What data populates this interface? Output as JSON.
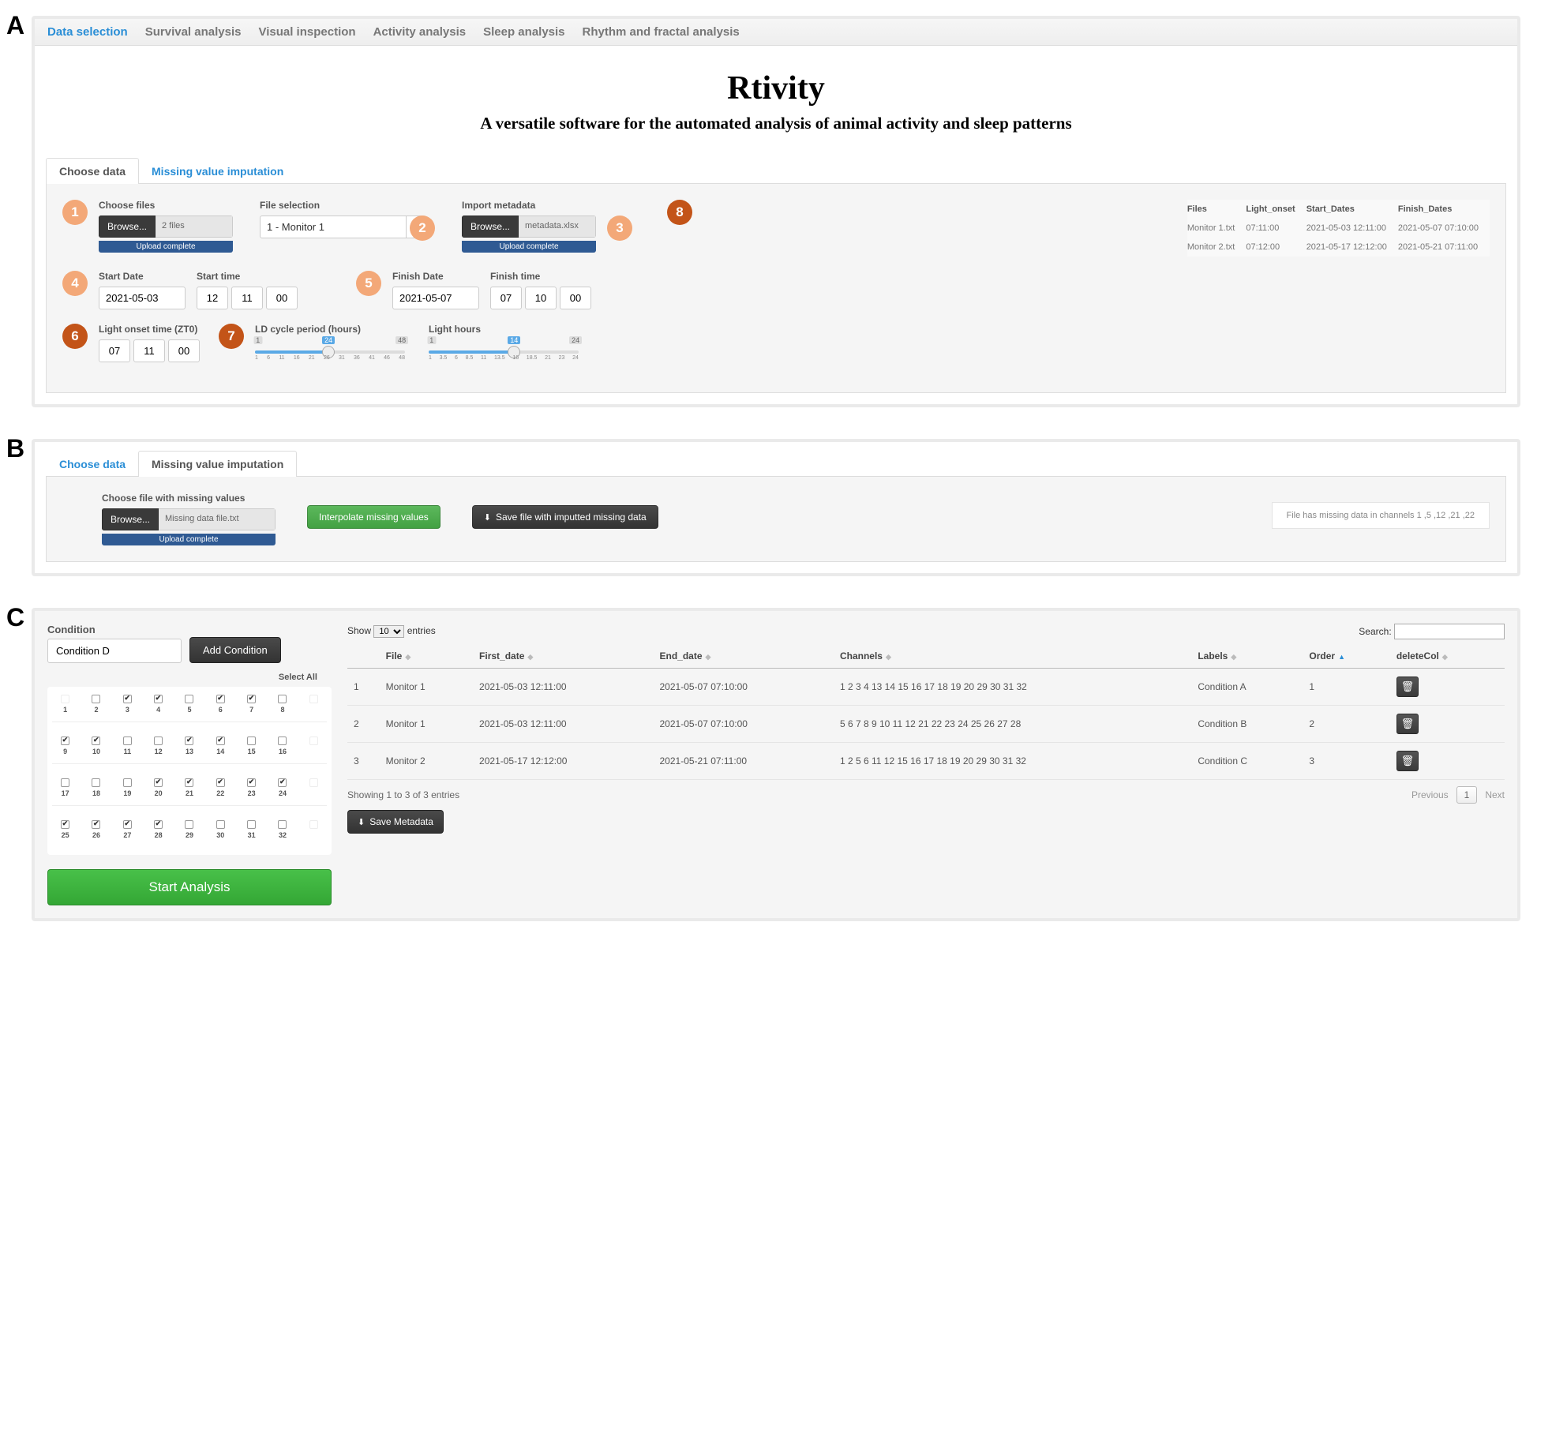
{
  "labels": {
    "A": "A",
    "B": "B",
    "C": "C"
  },
  "nav": {
    "items": [
      {
        "label": "Data selection",
        "active": true
      },
      {
        "label": "Survival analysis"
      },
      {
        "label": "Visual inspection"
      },
      {
        "label": "Activity analysis"
      },
      {
        "label": "Sleep analysis"
      },
      {
        "label": "Rhythm and fractal analysis"
      }
    ]
  },
  "hero": {
    "title": "Rtivity",
    "subtitle": "A versatile software for the automated analysis of animal activity and sleep patterns"
  },
  "tabs": {
    "choose_data": "Choose data",
    "missing_imputation": "Missing value imputation"
  },
  "callouts": [
    "1",
    "2",
    "3",
    "4",
    "5",
    "6",
    "7",
    "8"
  ],
  "panelA": {
    "choose_files_label": "Choose files",
    "browse_label": "Browse...",
    "files_count_text": "2 files",
    "upload_complete": "Upload complete",
    "file_selection_label": "File selection",
    "file_selection_value": "1 - Monitor 1",
    "import_metadata_label": "Import metadata",
    "metadata_filename": "metadata.xlsx",
    "start_date_label": "Start Date",
    "start_date_value": "2021-05-03",
    "start_time_label": "Start time",
    "start_time": {
      "h": "12",
      "m": "11",
      "s": "00"
    },
    "finish_date_label": "Finish Date",
    "finish_date_value": "2021-05-07",
    "finish_time_label": "Finish time",
    "finish_time": {
      "h": "07",
      "m": "10",
      "s": "00"
    },
    "zt0_label": "Light onset time (ZT0)",
    "zt0": {
      "h": "07",
      "m": "11",
      "s": "00"
    },
    "ld_label": "LD cycle period (hours)",
    "ld": {
      "min": "1",
      "value": "24",
      "max": "48",
      "ticks": [
        "1",
        "6",
        "11",
        "16",
        "21",
        "26",
        "31",
        "36",
        "41",
        "46",
        "48"
      ]
    },
    "light_label": "Light hours",
    "light": {
      "min": "1",
      "value": "14",
      "max": "24",
      "ticks": [
        "1",
        "3.5",
        "6",
        "8.5",
        "11",
        "13.5",
        "16",
        "18.5",
        "21",
        "23",
        "24"
      ]
    },
    "meta_headers": [
      "Files",
      "Light_onset",
      "Start_Dates",
      "Finish_Dates"
    ],
    "meta_rows": [
      {
        "file": "Monitor 1.txt",
        "onset": "07:11:00",
        "start": "2021-05-03 12:11:00",
        "finish": "2021-05-07 07:10:00"
      },
      {
        "file": "Monitor 2.txt",
        "onset": "07:12:00",
        "start": "2021-05-17 12:12:00",
        "finish": "2021-05-21 07:11:00"
      }
    ]
  },
  "panelB": {
    "choose_label": "Choose file with missing values",
    "filename": "Missing data file.txt",
    "interpolate_label": "Interpolate missing values",
    "save_label": "Save file with imputted missing data",
    "info_text": "File has missing data in channels 1 ,5 ,12 ,21 ,22"
  },
  "panelC": {
    "condition_label": "Condition",
    "condition_value": "Condition D",
    "add_condition_label": "Add Condition",
    "select_all_label": "Select All",
    "channels": [
      [
        {
          "n": "1",
          "c": false,
          "dim": true
        },
        {
          "n": "2",
          "c": false
        },
        {
          "n": "3",
          "c": true
        },
        {
          "n": "4",
          "c": true
        },
        {
          "n": "5",
          "c": false
        },
        {
          "n": "6",
          "c": true
        },
        {
          "n": "7",
          "c": true
        },
        {
          "n": "8",
          "c": false
        },
        {
          "n": "",
          "dim": true
        }
      ],
      [
        {
          "n": "9",
          "c": true
        },
        {
          "n": "10",
          "c": true
        },
        {
          "n": "11",
          "c": false
        },
        {
          "n": "12",
          "c": false
        },
        {
          "n": "13",
          "c": true
        },
        {
          "n": "14",
          "c": true
        },
        {
          "n": "15",
          "c": false
        },
        {
          "n": "16",
          "c": false
        },
        {
          "n": "",
          "dim": true
        }
      ],
      [
        {
          "n": "17",
          "c": false
        },
        {
          "n": "18",
          "c": false
        },
        {
          "n": "19",
          "c": false
        },
        {
          "n": "20",
          "c": true
        },
        {
          "n": "21",
          "c": true
        },
        {
          "n": "22",
          "c": true
        },
        {
          "n": "23",
          "c": true
        },
        {
          "n": "24",
          "c": true
        },
        {
          "n": "",
          "dim": true
        }
      ],
      [
        {
          "n": "25",
          "c": true
        },
        {
          "n": "26",
          "c": true
        },
        {
          "n": "27",
          "c": true
        },
        {
          "n": "28",
          "c": true
        },
        {
          "n": "29",
          "c": false
        },
        {
          "n": "30",
          "c": false
        },
        {
          "n": "31",
          "c": false
        },
        {
          "n": "32",
          "c": false
        },
        {
          "n": "",
          "dim": true
        }
      ]
    ],
    "start_analysis_label": "Start Analysis",
    "show_label": "Show",
    "entries_label": "entries",
    "length_value": "10",
    "search_label": "Search:",
    "search_value": "",
    "table_headers": [
      "",
      "File",
      "First_date",
      "End_date",
      "Channels",
      "Labels",
      "Order",
      "deleteCol"
    ],
    "sorted_col": "Order",
    "rows": [
      {
        "idx": "1",
        "file": "Monitor 1",
        "first": "2021-05-03 12:11:00",
        "end": "2021-05-07 07:10:00",
        "ch": "1 2 3 4 13 14 15 16 17 18 19 20 29 30 31 32",
        "label": "Condition A",
        "order": "1"
      },
      {
        "idx": "2",
        "file": "Monitor 1",
        "first": "2021-05-03 12:11:00",
        "end": "2021-05-07 07:10:00",
        "ch": "5 6 7 8 9 10 11 12 21 22 23 24 25 26 27 28",
        "label": "Condition B",
        "order": "2"
      },
      {
        "idx": "3",
        "file": "Monitor 2",
        "first": "2021-05-17 12:12:00",
        "end": "2021-05-21 07:11:00",
        "ch": "1 2 5 6 11 12 15 16 17 18 19 20 29 30 31 32",
        "label": "Condition C",
        "order": "3"
      }
    ],
    "info_text": "Showing 1 to 3 of 3 entries",
    "prev_label": "Previous",
    "next_label": "Next",
    "page_label": "1",
    "save_metadata_label": "Save Metadata"
  }
}
